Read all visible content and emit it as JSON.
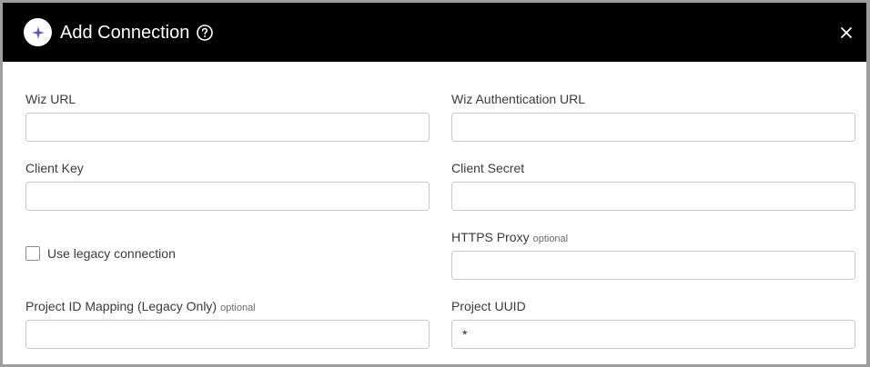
{
  "dialog": {
    "title": "Add Connection",
    "help_icon": "help-circle-icon",
    "close_icon": "close-icon",
    "logo_icon": "sparkle-icon",
    "accent_color": "#5b4de8"
  },
  "form": {
    "wiz_url": {
      "label": "Wiz URL",
      "value": ""
    },
    "wiz_auth_url": {
      "label": "Wiz Authentication URL",
      "value": ""
    },
    "client_key": {
      "label": "Client Key",
      "value": ""
    },
    "client_secret": {
      "label": "Client Secret",
      "value": ""
    },
    "legacy": {
      "label": "Use legacy connection",
      "checked": false
    },
    "https_proxy": {
      "label": "HTTPS Proxy",
      "optional": "optional",
      "value": ""
    },
    "project_id_mapping": {
      "label": "Project ID Mapping (Legacy Only)",
      "optional": "optional",
      "value": ""
    },
    "project_uuid": {
      "label": "Project UUID",
      "value": "*"
    }
  }
}
